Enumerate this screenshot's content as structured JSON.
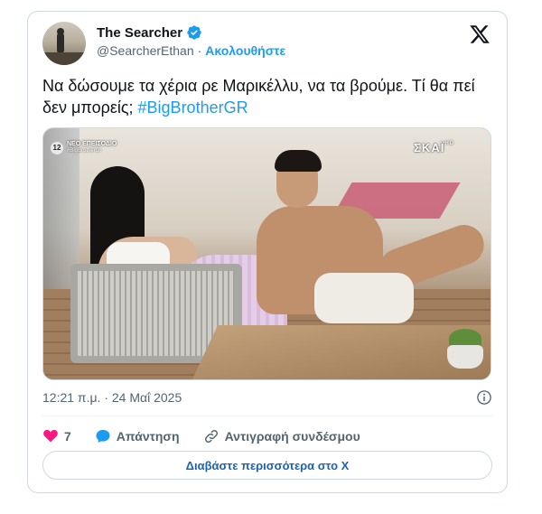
{
  "author": {
    "display_name": "The Searcher",
    "handle": "@SearcherEthan",
    "separator": "·",
    "follow_label": "Ακολουθήστε"
  },
  "tweet": {
    "text": "Να δώσουμε τα χέρια ρε Μαρικέλλυ, να τα βρούμε. Τί θα πεί δεν μπορείς; ",
    "hashtag": "#BigBrotherGR"
  },
  "media": {
    "episode_label": "ΝΕΟ ΕΠΕΙΣΟΔΙΟ",
    "episode_sub": "#BigBrotherGr",
    "episode_rating": "12",
    "channel_logo": "ΣΚΑΪ",
    "channel_hd": "HD"
  },
  "timestamp": "12:21 π.μ. · 24 Μαΐ 2025",
  "actions": {
    "like_count": "7",
    "reply_label": "Απάντηση",
    "copy_link_label": "Αντιγραφή συνδέσμου"
  },
  "read_more_label": "Διαβάστε περισσότερα στο X",
  "icons": [
    "verified-badge-icon",
    "x-logo-icon",
    "info-icon",
    "heart-icon",
    "reply-bubble-icon",
    "link-icon"
  ],
  "colors": {
    "accent": "#1d9bf0",
    "like": "#f91880",
    "muted": "#536471",
    "border": "#cfd9de"
  }
}
